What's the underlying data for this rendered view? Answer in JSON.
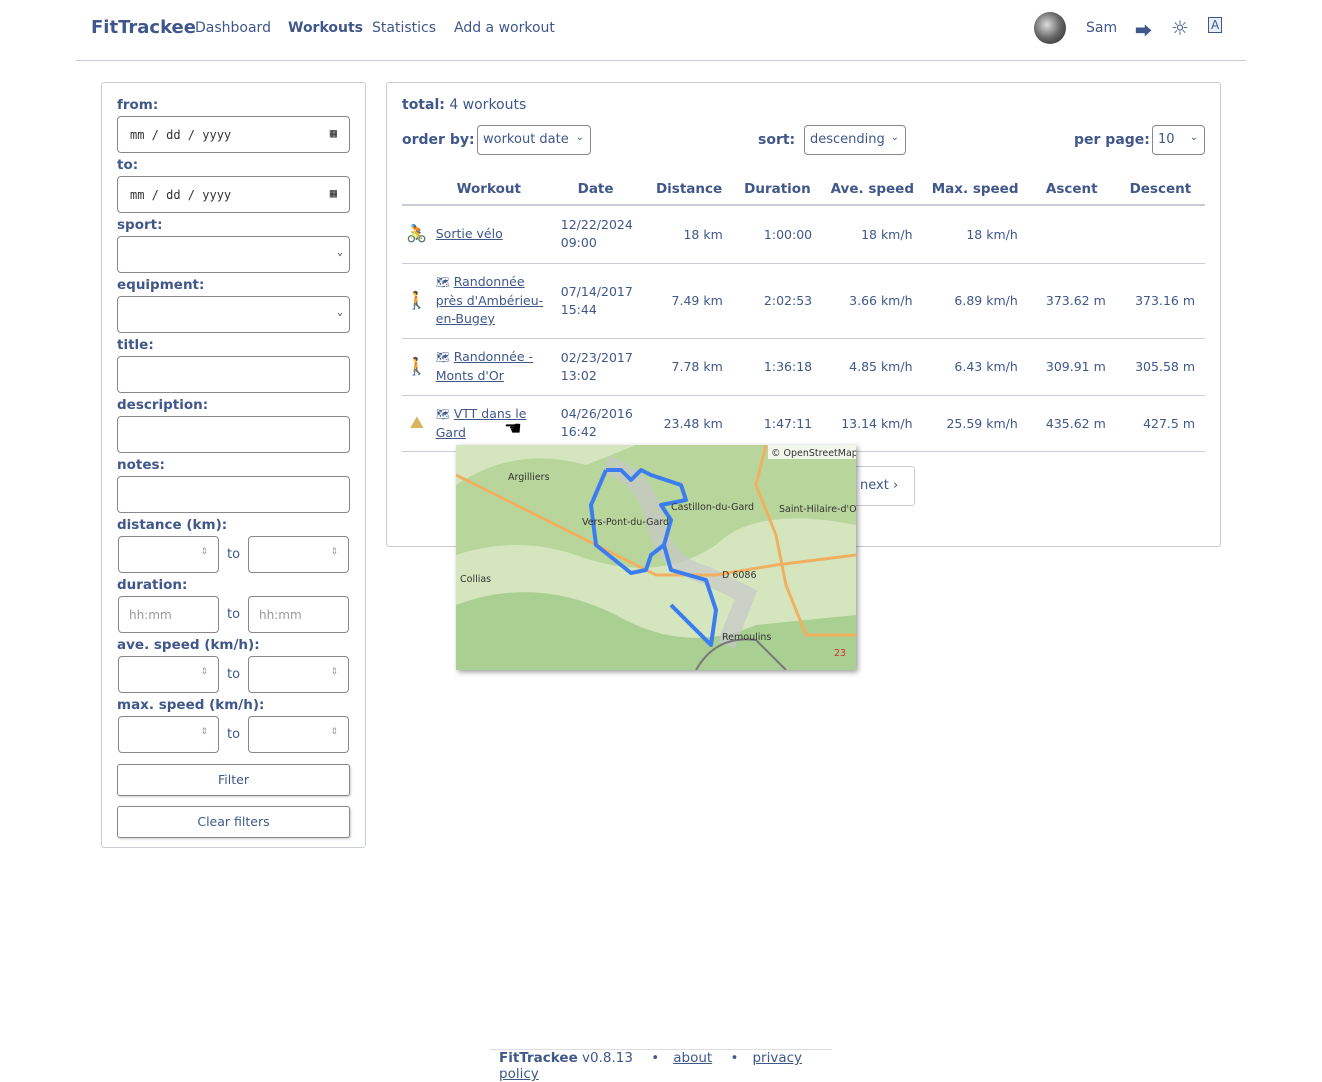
{
  "nav": {
    "brand": "FitTrackee",
    "links": [
      "Dashboard",
      "Workouts",
      "Statistics",
      "Add a workout"
    ],
    "active": "Workouts",
    "user": "Sam"
  },
  "filters": {
    "from_label": "from:",
    "from_placeholder": "mm / dd / yyyy",
    "to_label": "to:",
    "to_placeholder": "mm / dd / yyyy",
    "sport_label": "sport:",
    "equipment_label": "equipment:",
    "title_label": "title:",
    "description_label": "description:",
    "notes_label": "notes:",
    "distance_label": "distance (km):",
    "duration_label": "duration:",
    "duration_placeholder": "hh:mm",
    "ave_speed_label": "ave. speed (km/h):",
    "max_speed_label": "max. speed (km/h):",
    "to_word": "to",
    "filter_button": "Filter",
    "clear_button": "Clear filters"
  },
  "list": {
    "total_label": "total:",
    "total_value": "4 workouts",
    "order_label": "order by:",
    "order_value": "workout date",
    "sort_label": "sort:",
    "sort_value": "descending",
    "per_page_label": "per page:",
    "per_page_value": "10",
    "columns": [
      "Workout",
      "Date",
      "Distance",
      "Duration",
      "Ave. speed",
      "Max. speed",
      "Ascent",
      "Descent"
    ],
    "rows": [
      {
        "sport": "cycling",
        "title": "Sortie vélo",
        "has_map": false,
        "date": "12/22/2024",
        "time": "09:00",
        "distance": "18 km",
        "duration": "1:00:00",
        "ave": "18 km/h",
        "max": "18 km/h",
        "ascent": "",
        "descent": ""
      },
      {
        "sport": "hiking",
        "title": "Randonnée près d'Ambérieu-en-Bugey",
        "has_map": true,
        "date": "07/14/2017",
        "time": "15:44",
        "distance": "7.49 km",
        "duration": "2:02:53",
        "ave": "3.66 km/h",
        "max": "6.89 km/h",
        "ascent": "373.62 m",
        "descent": "373.16 m"
      },
      {
        "sport": "hiking",
        "title": "Randonnée - Monts d'Or",
        "has_map": true,
        "date": "02/23/2017",
        "time": "13:02",
        "distance": "7.78 km",
        "duration": "1:36:18",
        "ave": "4.85 km/h",
        "max": "6.43 km/h",
        "ascent": "309.91 m",
        "descent": "305.58 m"
      },
      {
        "sport": "mountain-biking",
        "title": "VTT dans le Gard",
        "has_map": true,
        "date": "04/26/2016",
        "time": "16:42",
        "distance": "23.48 km",
        "duration": "1:47:11",
        "ave": "13.14 km/h",
        "max": "25.59 km/h",
        "ascent": "435.62 m",
        "descent": "427.5 m"
      }
    ],
    "next_label": "next"
  },
  "map": {
    "attribution": "© OpenStreetMap",
    "places": [
      "Argilliers",
      "Castillon-du-Gard",
      "Vers-Pont-du-Gard",
      "Saint-Hilaire-d'Ozilhan",
      "Collias",
      "D 6086",
      "Remoulins",
      "23"
    ],
    "route_color": "#3b7df0"
  },
  "footer": {
    "app": "FitTrackee",
    "version": "v0.8.13",
    "about": "about",
    "privacy": "privacy policy"
  },
  "colors": {
    "primary": "#40578a",
    "cycling": "#3a9e8c",
    "hiking": "#b9504a",
    "mtb": "#d9b45c"
  }
}
